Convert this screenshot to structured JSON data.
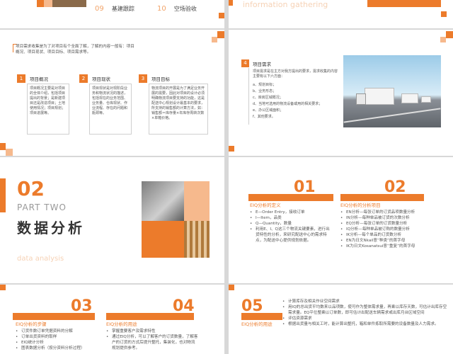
{
  "slide_top_left": {
    "items": [
      {
        "num": "09",
        "label": "基建跟踪"
      },
      {
        "num": "10",
        "label": "空场验收"
      }
    ]
  },
  "slide_top_right": {
    "ghost_text": "information gathering"
  },
  "slide_info": {
    "intro": "项目需求收集是为了对项目有个全面了解，了解的内容一般有：项目概况、项目现状、项目目标、项目需求等。",
    "cards": [
      {
        "num": "1",
        "title": "项目概况",
        "body": "项目概况主要是对项目的全体介绍，包括项目提出的背景；是新建项目还是改造项目；土地使用情况；项目规划；项目进展等。"
      },
      {
        "num": "2",
        "title": "项目现状",
        "body": "项目现状是对现阶段业务和物流状况的描述，包括现在的业务范围、业务量、仓库现状、作业流程、存在的问题和瓶颈等。"
      },
      {
        "num": "3",
        "title": "项目目标",
        "body": "物流项目的开展是为了满足业务开展的需要，因此对项目的设计必须明确物流项目要支持的功能，这是配送中心规划设计最基本的要求，所支持的销售额的计算方法，如：销售额＝库存量×年库存周转次数×单箱价格。"
      }
    ]
  },
  "slide_need": {
    "num": "4",
    "title": "项目需求",
    "intro": "项目需求是在主方对我方提出的要求，需求收集的内容主要有以下六方面：",
    "items": [
      "a、规划目标；",
      "b、业务形态；",
      "c、库房区域概况；",
      "d、当地可选用的物流设备或用的相关要求；",
      "e、办公区域面积；",
      "f、其他要求。"
    ]
  },
  "slide_section": {
    "num": "02",
    "part": "PART TWO",
    "title": "数据分析",
    "subtitle": "data analysis"
  },
  "slide_eiq": {
    "left": {
      "num": "01",
      "title": "EIQ分析的定义",
      "items": [
        "E—Order Entry，接收订单",
        "I—Item，品类",
        "Q—Quantity，数量",
        "利用E、I、Q这三个物流关键要素，进行出货特性的分析，来研究配送中心的需求特点，为配送中心提供规划依据。"
      ]
    },
    "right": {
      "num": "02",
      "title": "EIQ分析的分析项目",
      "items": [
        "EN分析—每张订单的订货品项数量分析",
        "IN分析—每种单品被订货的次数分析",
        "EQ分析—每张订单的订货数量分析",
        "IQ分析—每种单品被订购的数量分析",
        "IK分析—每个单品的订货数分析",
        "EN为日文Nkail意“种类”的首字母",
        "IK为日文Kosanatsui意“重复”的首字母"
      ]
    }
  },
  "slide_step": {
    "left": {
      "num": "03",
      "title": "EIQ分析的步骤",
      "items": [
        "订货件数订单凭据资料的分解",
        "订单出货资料的取样",
        "EIQ统计分析",
        "图表数据分析（按分资料分析过程）"
      ]
    },
    "right": {
      "num": "04",
      "title": "EIQ分析的用途",
      "items": [
        "掌握重要客户及需求特性",
        "通过EIQ分析，可以了解客户的订货数量，了解客户的订货的方式后提升整托，集装化，也对物流规划提供参考。"
      ]
    }
  },
  "slide_use": {
    "num": "05",
    "title": "EIQ分析的用途",
    "items": [
      "计算库存及相关作业空间需求",
      "用IQ的总出货平均数来以品项数，使可作为整体需求量，再乘以库存天数，可估计出库存空需求量。EQ平位整乘以订单数，即可估计出配送车辆需求或出库月台区域空间",
      "评估资源需求",
      "根据出货量与相关工时，能计算出整托，箱和单件拣取所需要的设备数量及人力需求。"
    ]
  },
  "colors": {
    "accent": "#ec7b2b",
    "accent_light": "#f6b98d"
  }
}
